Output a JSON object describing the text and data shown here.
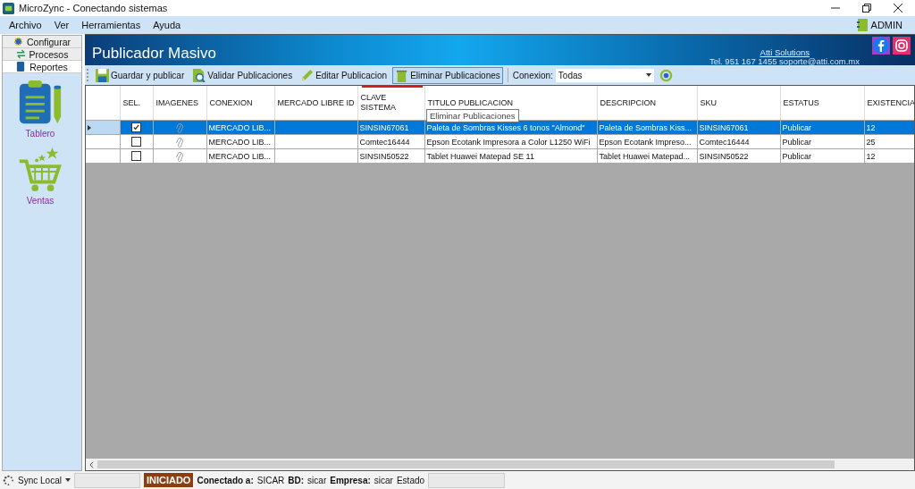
{
  "window": {
    "title": "MicroZync - Conectando sistemas"
  },
  "menu": [
    "Archivo",
    "Ver",
    "Herramientas",
    "Ayuda"
  ],
  "user": "ADMIN",
  "sidebar": {
    "tabs": [
      {
        "label": "Configurar",
        "selected": false
      },
      {
        "label": "Procesos",
        "selected": false
      },
      {
        "label": "Reportes",
        "selected": true
      }
    ],
    "items": [
      {
        "label": "Tablero",
        "kind": "clipboard"
      },
      {
        "label": "Ventas",
        "kind": "cart"
      }
    ]
  },
  "banner": {
    "title": "Publicador Masivo",
    "company": "Atti Solutions",
    "contact": "Tel. 951 167 1455  soporte@atti.com.mx"
  },
  "toolbar": {
    "buttons": [
      {
        "label": "Guardar y publicar",
        "kind": "save",
        "selected": false
      },
      {
        "label": "Validar Publicaciones",
        "kind": "validate",
        "selected": false
      },
      {
        "label": "Editar Publicacion",
        "kind": "edit",
        "selected": false
      },
      {
        "label": "Eliminar Publicaciones",
        "kind": "delete",
        "selected": true
      }
    ],
    "filter_label": "Conexion:",
    "filter_value": "Todas"
  },
  "tooltip": "Eliminar Publicaciones",
  "table": {
    "columns": [
      "SEL.",
      "IMAGENES",
      "CONEXION",
      "MERCADO LIBRE ID",
      "CLAVE SISTEMA",
      "TITULO PUBLICACION",
      "DESCRIPCION",
      "SKU",
      "ESTATUS",
      "EXISTENCIA"
    ],
    "rows": [
      {
        "selected": true,
        "checked": true,
        "conexion": "MERCADO LIB...",
        "clave": "SINSIN67061",
        "titulo": "Paleta de Sombras Kisses 6 tonos \"Almond\"",
        "descripcion": "Paleta de Sombras Kiss...",
        "sku": "SINSIN67061",
        "estatus": "Publicar",
        "existencia": "12"
      },
      {
        "selected": false,
        "checked": false,
        "conexion": "MERCADO LIB...",
        "clave": "Comtec16444",
        "titulo": "Epson Ecotank Impresora a Color L1250 WiFi",
        "descripcion": "Epson Ecotank Impreso...",
        "sku": "Comtec16444",
        "estatus": "Publicar",
        "existencia": "25"
      },
      {
        "selected": false,
        "checked": false,
        "conexion": "MERCADO LIB...",
        "clave": "SINSIN50522",
        "titulo": "Tablet Huawei Matepad SE 11",
        "descripcion": "Tablet Huawei Matepad...",
        "sku": "SINSIN50522",
        "estatus": "Publicar",
        "existencia": "12"
      }
    ]
  },
  "status_bar": {
    "sync": "Sync Local",
    "state": "INICIADO",
    "fields": [
      {
        "label": "Conectado a:",
        "value": "SICAR"
      },
      {
        "label": "BD:",
        "value": "sicar"
      },
      {
        "label": "Empresa:",
        "value": "sicar"
      }
    ],
    "estado": "Estado"
  }
}
